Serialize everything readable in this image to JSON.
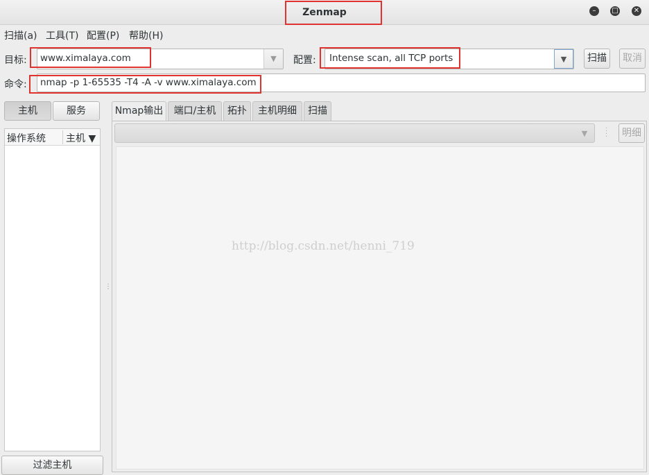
{
  "window": {
    "title": "Zenmap"
  },
  "menu": {
    "items": [
      "扫描(a)",
      "工具(T)",
      "配置(P)",
      "帮助(H)"
    ]
  },
  "target": {
    "label": "目标:",
    "value": "www.ximalaya.com"
  },
  "profile": {
    "label": "配置:",
    "value": "Intense scan, all TCP ports"
  },
  "buttons": {
    "scan": "扫描",
    "cancel": "取消",
    "hosts": "主机",
    "services": "服务",
    "filter_hosts": "过滤主机",
    "details": "明细"
  },
  "command": {
    "label": "命令:",
    "value": "nmap -p 1-65535 -T4 -A -v www.ximalaya.com"
  },
  "host_list": {
    "columns": [
      "操作系统",
      "主机 ▼"
    ]
  },
  "tabs": [
    "Nmap输出",
    "端口/主机",
    "拓扑",
    "主机明细",
    "扫描"
  ],
  "watermark": "http://blog.csdn.net/henni_719",
  "colors": {
    "annotation": "#e0322e",
    "background": "#ededed"
  }
}
